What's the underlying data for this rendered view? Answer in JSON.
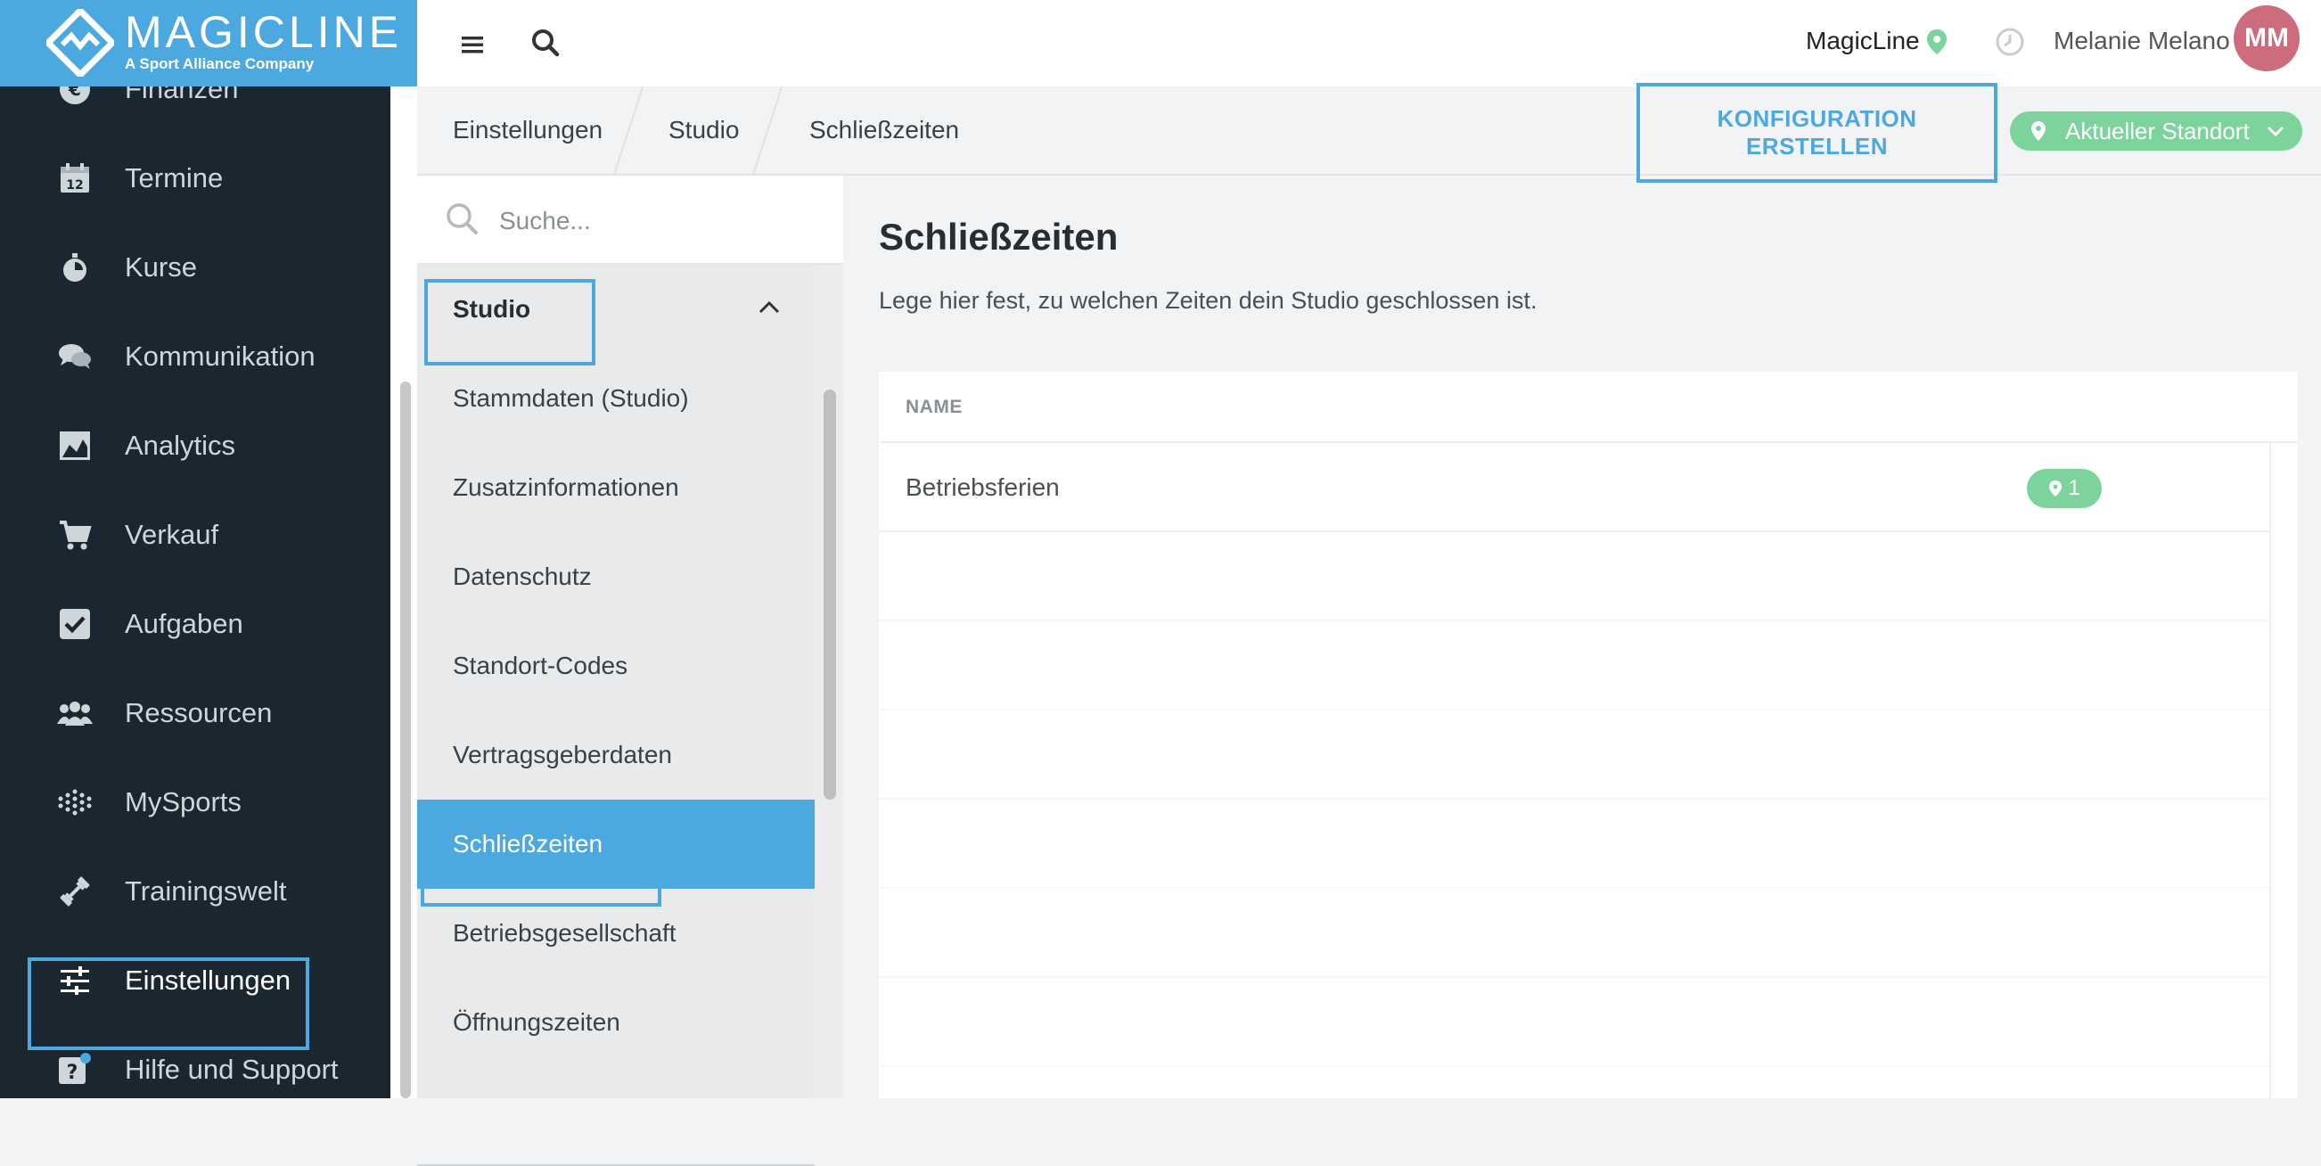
{
  "brand": {
    "name": "MAGICLINE",
    "tagline": "A Sport Alliance Company",
    "accent_color": "#4ba9df"
  },
  "nav": {
    "items": [
      {
        "label": "Finanzen",
        "icon": "euro-icon"
      },
      {
        "label": "Termine",
        "icon": "calendar-icon"
      },
      {
        "label": "Kurse",
        "icon": "stopwatch-icon"
      },
      {
        "label": "Kommunikation",
        "icon": "chat-icon"
      },
      {
        "label": "Analytics",
        "icon": "chart-image-icon"
      },
      {
        "label": "Verkauf",
        "icon": "cart-icon"
      },
      {
        "label": "Aufgaben",
        "icon": "checkbox-icon"
      },
      {
        "label": "Ressourcen",
        "icon": "people-icon"
      },
      {
        "label": "MySports",
        "icon": "dots-grid-icon"
      },
      {
        "label": "Trainingswelt",
        "icon": "dumbbell-icon"
      },
      {
        "label": "Einstellungen",
        "icon": "sliders-icon",
        "active": true
      },
      {
        "label": "Hilfe und Support",
        "icon": "help-icon"
      }
    ]
  },
  "topbar": {
    "studio_name": "MagicLine",
    "user_name": "Melanie Melano",
    "user_initials": "MM"
  },
  "breadcrumb": [
    "Einstellungen",
    "Studio",
    "Schließzeiten"
  ],
  "actions": {
    "create_config": "KONFIGURATION ERSTELLEN",
    "location_select": "Aktueller Standort"
  },
  "subnav": {
    "search_placeholder": "Suche...",
    "group_label": "Studio",
    "items": [
      "Stammdaten (Studio)",
      "Zusatzinformationen",
      "Datenschutz",
      "Standort-Codes",
      "Vertragsgeberdaten",
      "Schließzeiten",
      "Betriebsgesellschaft",
      "Öffnungszeiten"
    ],
    "selected": "Schließzeiten"
  },
  "main": {
    "title": "Schließzeiten",
    "description": "Lege hier fest, zu welchen Zeiten dein Studio geschlossen ist.",
    "table": {
      "columns": [
        "NAME"
      ],
      "rows": [
        {
          "name": "Betriebsferien",
          "location_count": "1"
        }
      ]
    }
  }
}
